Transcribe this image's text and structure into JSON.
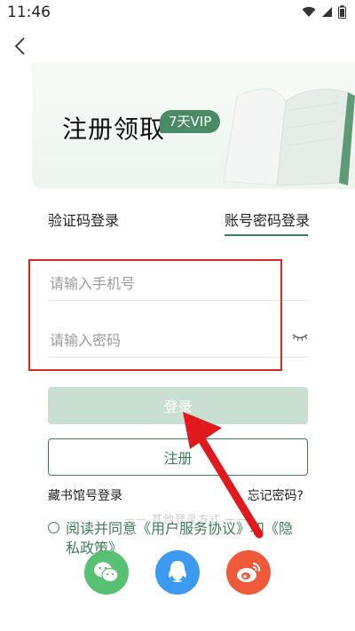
{
  "status_bar": {
    "time": "11:46"
  },
  "hero": {
    "title": "注册领取",
    "badge": "7天VIP"
  },
  "tabs": {
    "sms_login": "验证码登录",
    "password_login": "账号密码登录"
  },
  "form": {
    "phone_placeholder": "请输入手机号",
    "password_placeholder": "请输入密码"
  },
  "buttons": {
    "login": "登录",
    "register": "注册"
  },
  "links": {
    "library_login": "藏书馆号登录",
    "forgot_password": "忘记密码?"
  },
  "other_login_label": "—— 其他登录方式 ——",
  "agreement": {
    "text": "阅读并同意《用户服务协议》和《隐私政策》"
  },
  "icons": {
    "back": "chevron-left-icon",
    "wifi": "wifi-icon",
    "signal": "signal-icon",
    "battery": "battery-icon",
    "eye": "eye-closed-icon",
    "wechat": "wechat-icon",
    "qq": "qq-icon",
    "weibo": "weibo-icon"
  },
  "colors": {
    "accent": "#3f7d5a",
    "login_disabled": "#c9dfd1",
    "highlight": "#d6262a",
    "wechat": "#58c073",
    "qq": "#3c9bf1",
    "weibo": "#f0593a"
  }
}
